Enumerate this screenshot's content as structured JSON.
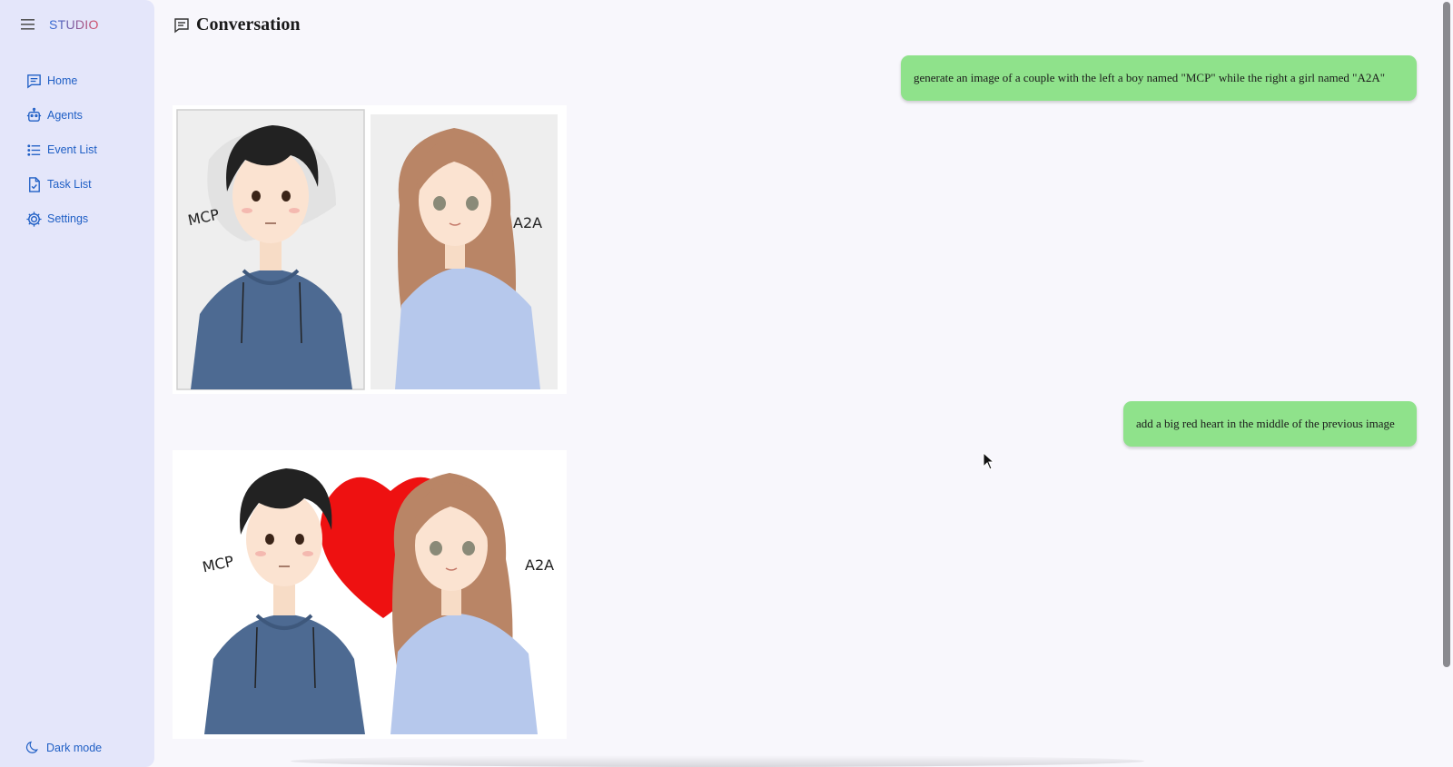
{
  "app": {
    "brand": "STUDIO",
    "colors": {
      "sidebar_bg": "#e4e6fa",
      "accent": "#1f5fc5",
      "user_bubble": "#8fe28b",
      "page_bg": "#f8f7fc"
    }
  },
  "sidebar": {
    "menu_icon": "hamburger-menu-icon",
    "items": [
      {
        "label": "Home",
        "icon": "chat-icon"
      },
      {
        "label": "Agents",
        "icon": "robot-icon"
      },
      {
        "label": "Event List",
        "icon": "list-icon"
      },
      {
        "label": "Task List",
        "icon": "task-icon"
      },
      {
        "label": "Settings",
        "icon": "gear-icon"
      }
    ],
    "dark_mode": {
      "label": "Dark mode",
      "icon": "moon-icon"
    }
  },
  "main": {
    "title": "Conversation",
    "title_icon": "message-square-icon",
    "messages": [
      {
        "role": "user",
        "text": "generate an image of a couple with the left a boy named \"MCP\" while the right a girl named \"A2A\""
      },
      {
        "role": "agent",
        "type": "image",
        "image_labels": [
          "MCP",
          "A2A"
        ]
      },
      {
        "role": "user",
        "text": "add a big red heart in the middle of the previous image"
      },
      {
        "role": "agent",
        "type": "image",
        "image_labels": [
          "MCP",
          "A2A"
        ]
      }
    ]
  }
}
